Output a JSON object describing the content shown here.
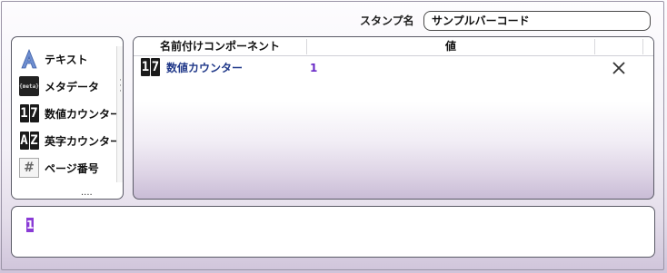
{
  "stamp": {
    "label": "スタンプ名",
    "name_value": "サンプルバーコード"
  },
  "palette": {
    "items": [
      {
        "label": "テキスト",
        "icon": "text-a-icon"
      },
      {
        "label": "メタデータ",
        "icon": "metadata-icon",
        "icon_text": "{meta}"
      },
      {
        "label": "数値カウンター",
        "icon": "number-counter-icon",
        "icon_text_1": "1",
        "icon_text_2": "7"
      },
      {
        "label": "英字カウンター",
        "icon": "alpha-counter-icon",
        "icon_text_1": "A",
        "icon_text_2": "Z"
      },
      {
        "label": "ページ番号",
        "icon": "page-number-icon",
        "icon_text": "#"
      }
    ],
    "more": "...."
  },
  "table": {
    "columns": [
      "名前付けコンポーネント",
      "値"
    ],
    "rows": [
      {
        "name": "数値カウンター",
        "value": "1",
        "icon_text_1": "1",
        "icon_text_2": "7"
      }
    ]
  },
  "preview": {
    "token": "1"
  },
  "colors": {
    "accent": "#8a3bd6",
    "link": "#223a8a",
    "value": "#6a2bc7"
  }
}
